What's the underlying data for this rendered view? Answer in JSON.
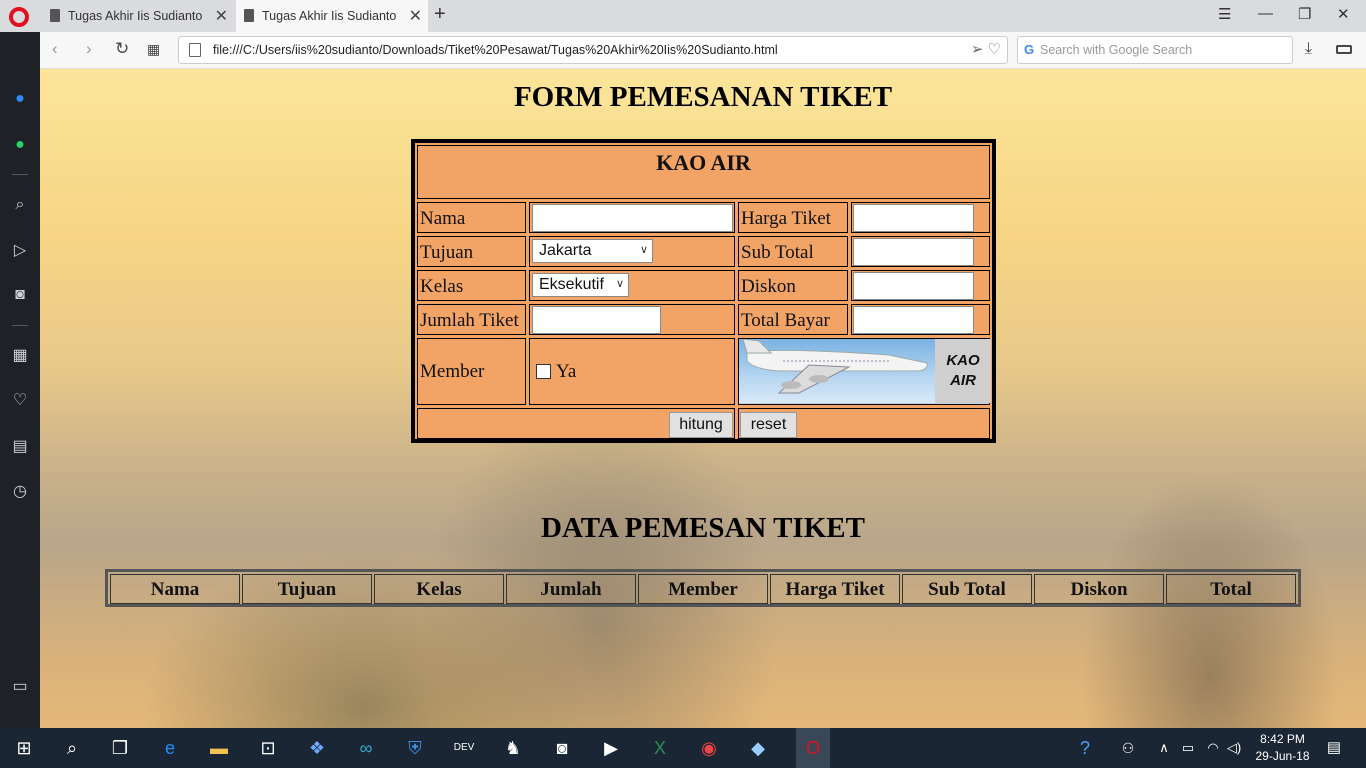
{
  "browser": {
    "tabs": [
      {
        "label": "Tugas Akhir Iis Sudianto"
      },
      {
        "label": "Tugas Akhir Iis Sudianto"
      }
    ],
    "url": "file:///C:/Users/iis%20sudianto/Downloads/Tiket%20Pesawat/Tugas%20Akhir%20Iis%20Sudianto.html",
    "search_placeholder": "Search with Google Search"
  },
  "form": {
    "title": "FORM PEMESANAN TIKET",
    "airline": "KAO AIR",
    "fields": {
      "nama": "Nama",
      "tujuan": "Tujuan",
      "kelas": "Kelas",
      "jumlah_tiket": "Jumlah Tiket",
      "member": "Member",
      "harga_tiket": "Harga Tiket",
      "sub_total": "Sub Total",
      "diskon": "Diskon",
      "total_bayar": "Total Bayar"
    },
    "tujuan_selected": "Jakarta",
    "kelas_selected": "Eksekutif",
    "member_option": "Ya",
    "logo_text_line1": "KAO",
    "logo_text_line2": "AIR",
    "buttons": {
      "hitung": "hitung",
      "reset": "reset"
    }
  },
  "data_table": {
    "title": "DATA PEMESAN TIKET",
    "headers": [
      "Nama",
      "Tujuan",
      "Kelas",
      "Jumlah",
      "Member",
      "Harga Tiket",
      "Sub Total",
      "Diskon",
      "Total"
    ]
  },
  "taskbar": {
    "time": "8:42 PM",
    "date": "29-Jun-18"
  }
}
